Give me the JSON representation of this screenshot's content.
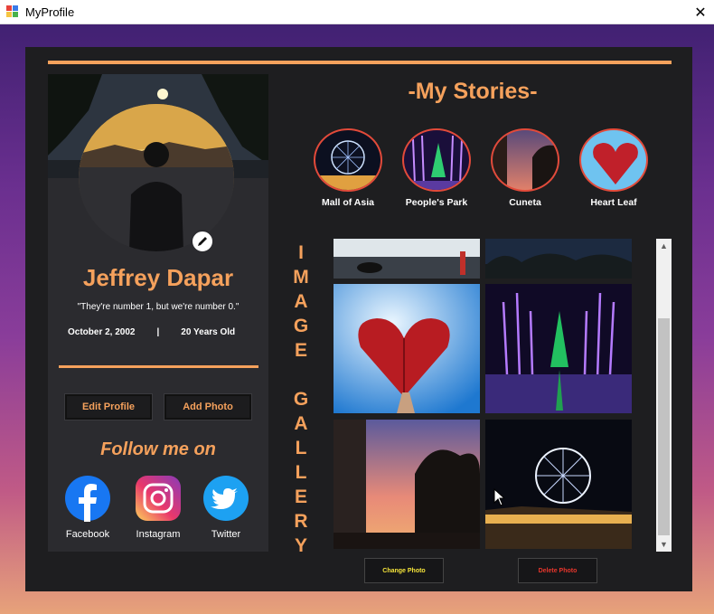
{
  "window": {
    "title": "MyProfile",
    "close_glyph": "✕"
  },
  "profile": {
    "name": "Jeffrey Dapar",
    "quote": "\"They're number 1, but we're number 0.\"",
    "birthday": "October 2, 2002",
    "separator": "|",
    "age": "20 Years Old",
    "edit_button": "Edit Profile",
    "add_photo_button": "Add Photo",
    "follow_heading": "Follow me on",
    "socials": [
      {
        "label": "Facebook",
        "icon": "facebook-icon",
        "color": "#1877f2"
      },
      {
        "label": "Instagram",
        "icon": "instagram-icon",
        "color": "#d6249f"
      },
      {
        "label": "Twitter",
        "icon": "twitter-icon",
        "color": "#1da1f2"
      }
    ]
  },
  "stories": {
    "title": "-My Stories-",
    "items": [
      {
        "label": "Mall of Asia"
      },
      {
        "label": "People's Park"
      },
      {
        "label": "Cuneta"
      },
      {
        "label": "Heart Leaf"
      }
    ]
  },
  "gallery": {
    "vertical_label": [
      "I",
      "M",
      "A",
      "G",
      "E",
      "",
      "G",
      "A",
      "L",
      "L",
      "E",
      "R",
      "Y"
    ],
    "change_button": "Change Photo",
    "delete_button": "Delete Photo"
  },
  "colors": {
    "accent": "#f5a15c",
    "change_text": "#f5e43a",
    "delete_text": "#e8362c"
  }
}
